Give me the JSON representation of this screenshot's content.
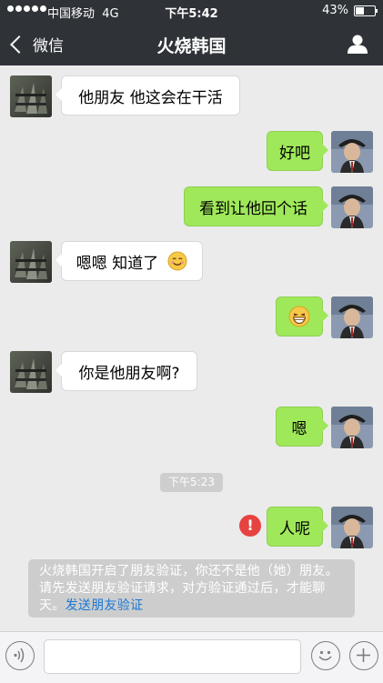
{
  "status_bar": {
    "carrier": "中国移动",
    "network": "4G",
    "time": "下午5:42",
    "battery": "43%",
    "battery_level": 0.43
  },
  "nav": {
    "back_label": "微信",
    "title": "火烧韩国",
    "back_icon": "chevron-left-icon",
    "contact_icon": "person-icon"
  },
  "messages": [
    {
      "side": "left",
      "text": "他朋友  他这会在干活"
    },
    {
      "side": "right",
      "text": "好吧"
    },
    {
      "side": "right",
      "text": "看到让他回个话"
    },
    {
      "side": "left",
      "text": "嗯嗯  知道了"
    },
    {
      "side": "right",
      "text": ""
    },
    {
      "side": "left",
      "text": "你是他朋友啊?"
    },
    {
      "side": "right",
      "text": "嗯"
    },
    {
      "side": "right",
      "text": "人呢"
    }
  ],
  "timestamp": "下午5:23",
  "error_mark": "!",
  "system_note": {
    "text": "火烧韩国开启了朋友验证，你还不是他（她）朋友。请先发送朋友验证请求，对方验证通过后，才能聊天。",
    "link": "发送朋友验证"
  },
  "colors": {
    "nav_bg": "#2f3338",
    "sent_bubble": "#9fe85a",
    "received_bubble": "#ffffff",
    "chat_bg": "#ebebeb",
    "error": "#e64340",
    "link": "#1a78d4"
  },
  "toolbar": {
    "voice_icon": "voice-icon",
    "emoji_icon": "emoji-icon",
    "add_icon": "plus-icon"
  }
}
